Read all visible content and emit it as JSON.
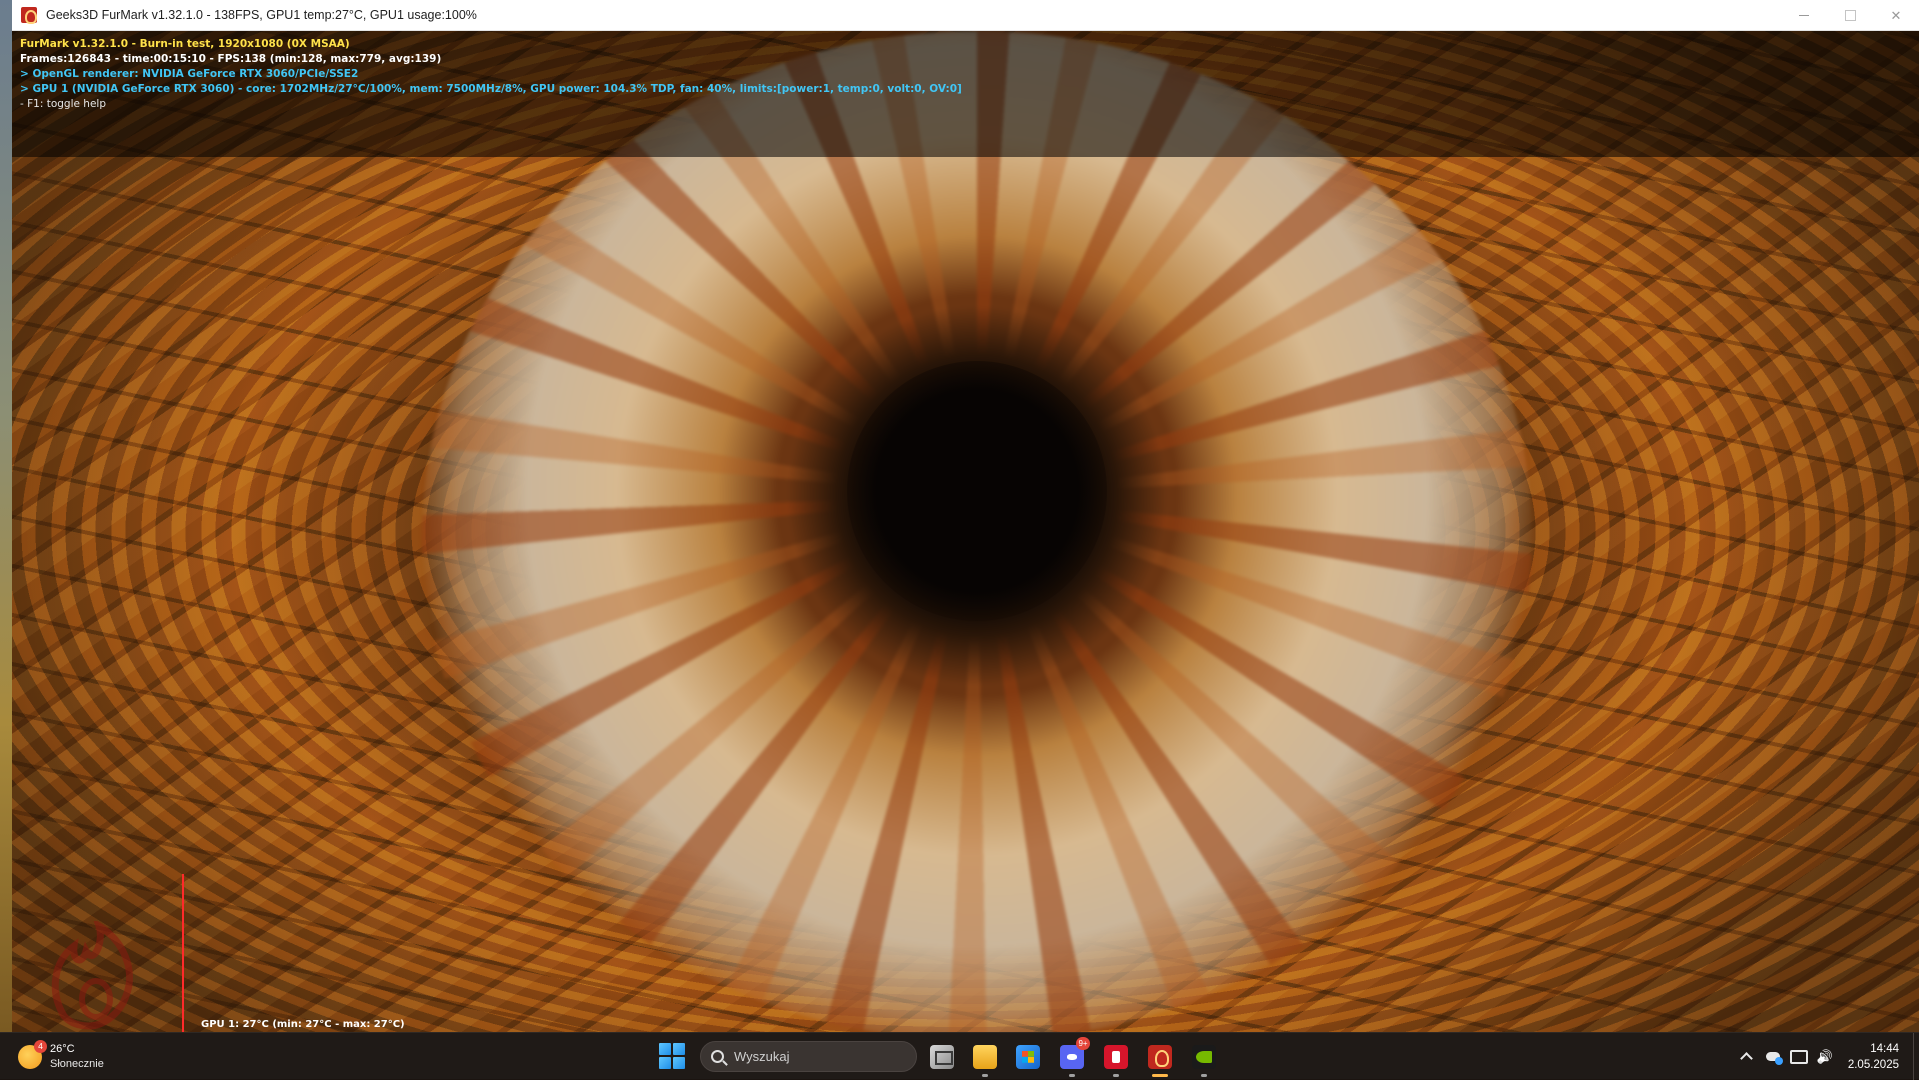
{
  "window": {
    "title": "Geeks3D FurMark v1.32.1.0 - 138FPS, GPU1 temp:27°C, GPU1 usage:100%"
  },
  "hud": {
    "line1": "FurMark v1.32.1.0 - Burn-in test, 1920x1080 (0X MSAA)",
    "line2": "Frames:126843 - time:00:15:10 - FPS:138 (min:128, max:779, avg:139)",
    "line3": "> OpenGL renderer: NVIDIA GeForce RTX 3060/PCIe/SSE2",
    "line4": "> GPU 1 (NVIDIA GeForce RTX 3060) - core: 1702MHz/27°C/100%, mem: 7500MHz/8%, GPU power: 104.3% TDP, fan: 40%, limits:[power:1, temp:0, volt:0, OV:0]",
    "line5": "- F1: toggle help"
  },
  "graph": {
    "label": "GPU 1: 27°C (min: 27°C - max: 27°C)",
    "line_color": "#ff2a2a"
  },
  "taskbar": {
    "weather": {
      "temp": "26°C",
      "condition": "Słonecznie",
      "badge": "4"
    },
    "search": {
      "placeholder": "Wyszukaj"
    },
    "apps": [
      {
        "name": "task-view",
        "icon": "task-view-icon"
      },
      {
        "name": "file-explorer",
        "icon": "folder-icon"
      },
      {
        "name": "microsoft-store",
        "icon": "store-icon"
      },
      {
        "name": "discord",
        "icon": "discord-icon",
        "badge": "9+"
      },
      {
        "name": "red-app",
        "icon": "app-icon"
      },
      {
        "name": "furmark",
        "icon": "furmark-icon"
      },
      {
        "name": "nvidia",
        "icon": "nvidia-icon"
      }
    ],
    "clock": {
      "time": "14:44",
      "date": "2.05.2025"
    }
  },
  "colors": {
    "hud_yellow": "#ffe24a",
    "hud_cyan": "#41c6f5",
    "taskbar_bg": "#1f1a17"
  }
}
